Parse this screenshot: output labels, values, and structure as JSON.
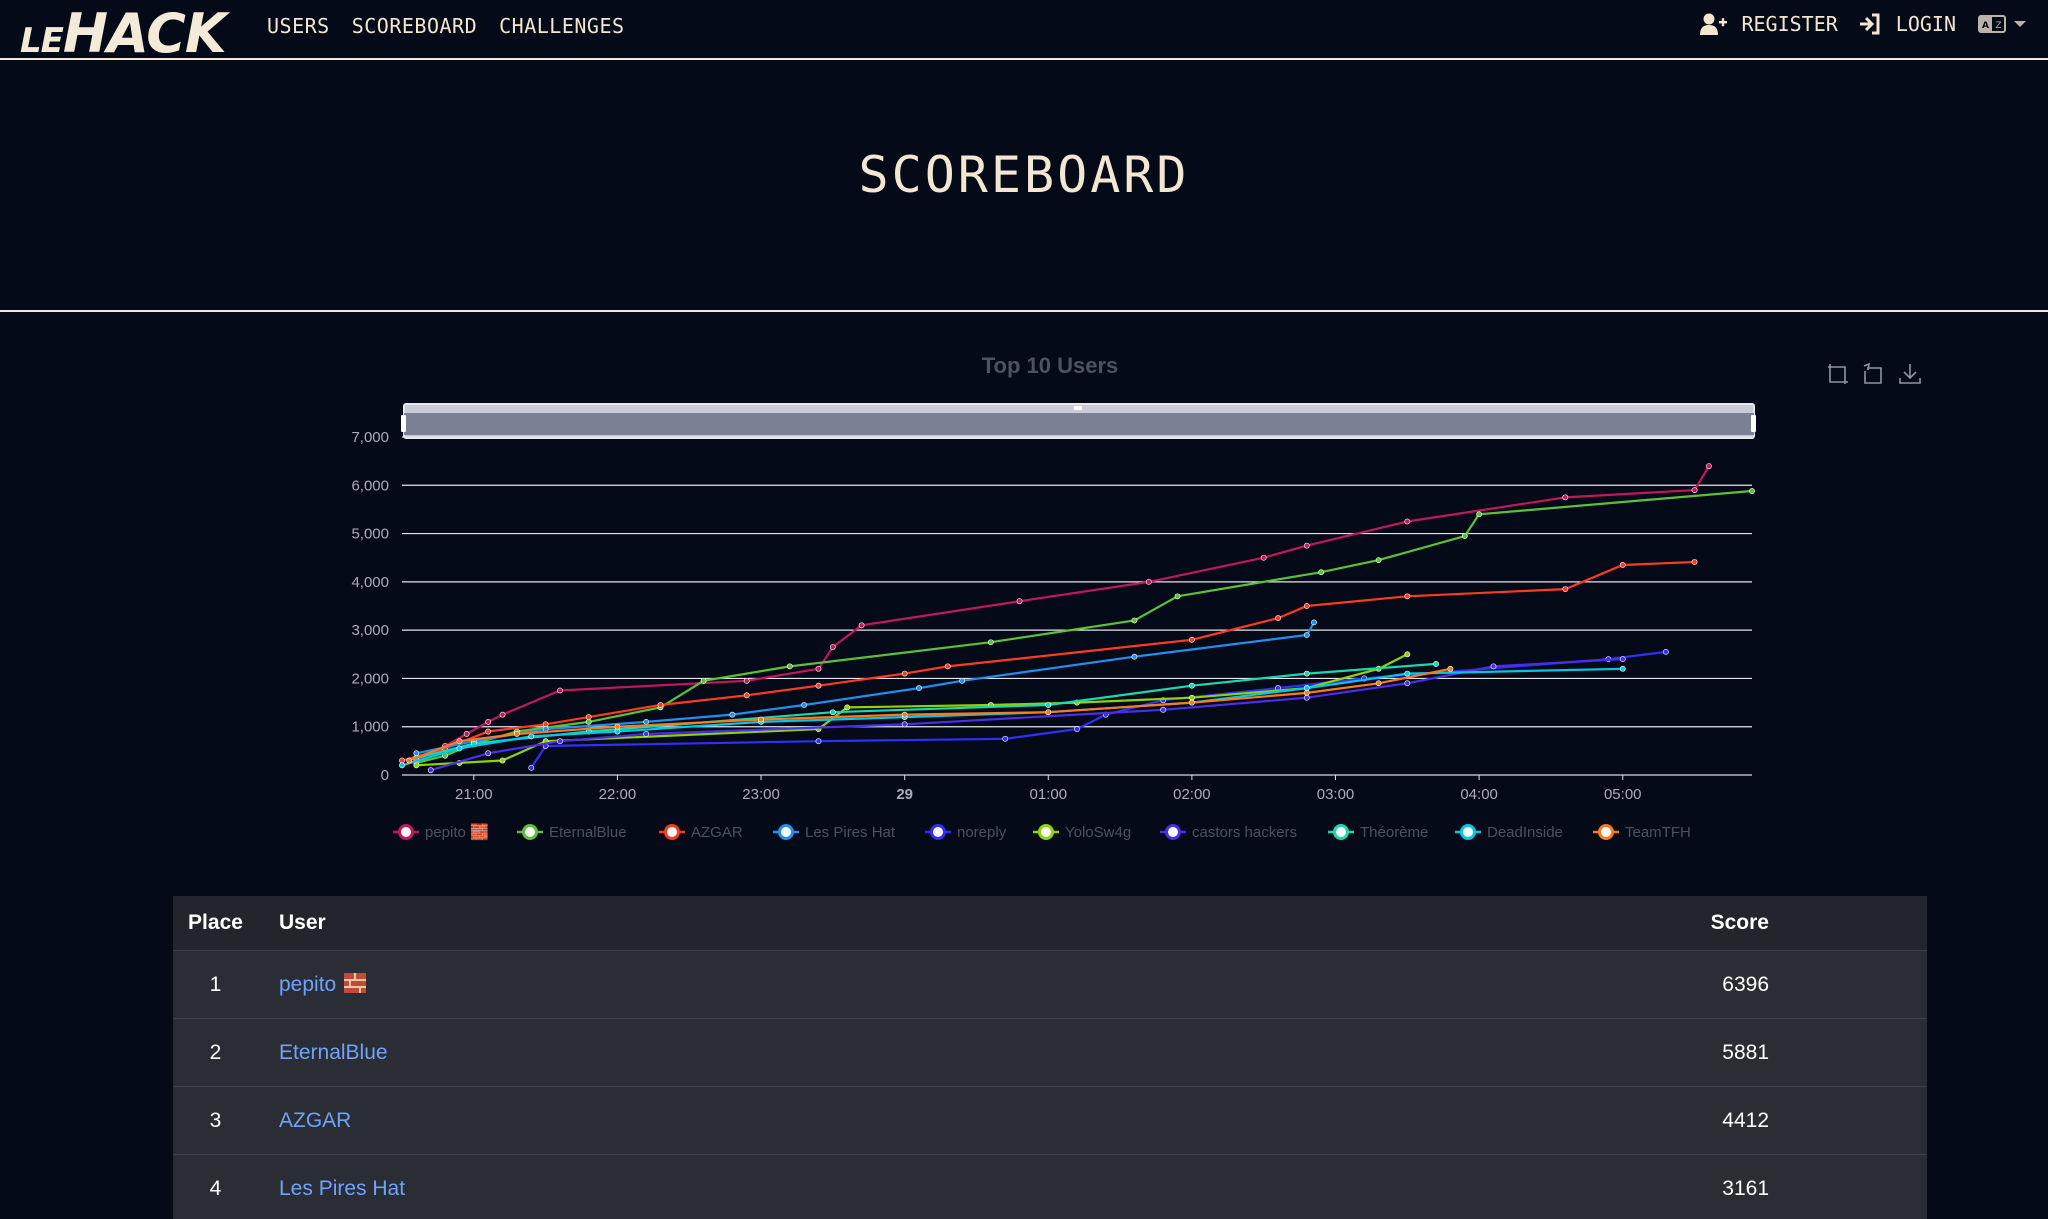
{
  "nav": {
    "logo_le": "LE",
    "logo_hack": "HACK",
    "links": [
      "USERS",
      "SCOREBOARD",
      "CHALLENGES"
    ],
    "register": "REGISTER",
    "login": "LOGIN",
    "icons": [
      "user-plus-icon",
      "sign-in-icon",
      "language-icon",
      "caret-down-icon"
    ]
  },
  "page": {
    "title": "SCOREBOARD"
  },
  "toolbox": [
    "zoom-icon",
    "zoom-reset-icon",
    "download-icon"
  ],
  "chart_data": {
    "type": "line",
    "title": "Top 10 Users",
    "y_axis": {
      "min": 0,
      "max": 7000,
      "ticks": [
        "0",
        "1,000",
        "2,000",
        "3,000",
        "4,000",
        "5,000",
        "6,000",
        "7,000"
      ]
    },
    "x_axis": {
      "min": 20.5,
      "max": 29.9,
      "ticks": [
        {
          "v": 21,
          "label": "21:00"
        },
        {
          "v": 22,
          "label": "22:00"
        },
        {
          "v": 23,
          "label": "23:00"
        },
        {
          "v": 24,
          "label": "29",
          "bold": true
        },
        {
          "v": 25,
          "label": "01:00"
        },
        {
          "v": 26,
          "label": "02:00"
        },
        {
          "v": 27,
          "label": "03:00"
        },
        {
          "v": 28,
          "label": "04:00"
        },
        {
          "v": 29,
          "label": "05:00"
        }
      ]
    },
    "grid": true,
    "legend": "bottom",
    "series": [
      {
        "name": "pepito 🧱",
        "color": "#c2185b",
        "points": [
          [
            20.6,
            300
          ],
          [
            20.8,
            600
          ],
          [
            20.95,
            850
          ],
          [
            21.1,
            1100
          ],
          [
            21.2,
            1250
          ],
          [
            21.6,
            1750
          ],
          [
            22.9,
            1950
          ],
          [
            23.4,
            2200
          ],
          [
            23.5,
            2650
          ],
          [
            23.7,
            3100
          ],
          [
            24.8,
            3600
          ],
          [
            25.7,
            4000
          ],
          [
            26.5,
            4500
          ],
          [
            26.8,
            4750
          ],
          [
            27.5,
            5250
          ],
          [
            28.6,
            5750
          ],
          [
            29.5,
            5900
          ],
          [
            29.6,
            6396
          ]
        ]
      },
      {
        "name": "EternalBlue",
        "color": "#5bc236",
        "points": [
          [
            20.6,
            250
          ],
          [
            20.8,
            400
          ],
          [
            21.0,
            650
          ],
          [
            21.3,
            900
          ],
          [
            21.8,
            1100
          ],
          [
            22.3,
            1400
          ],
          [
            22.6,
            1950
          ],
          [
            23.2,
            2250
          ],
          [
            24.6,
            2750
          ],
          [
            25.6,
            3200
          ],
          [
            25.9,
            3700
          ],
          [
            26.9,
            4200
          ],
          [
            27.3,
            4450
          ],
          [
            27.9,
            4950
          ],
          [
            28.0,
            5400
          ],
          [
            29.9,
            5881
          ]
        ]
      },
      {
        "name": "AZGAR",
        "color": "#ff3b1f",
        "points": [
          [
            20.5,
            300
          ],
          [
            20.8,
            550
          ],
          [
            21.1,
            900
          ],
          [
            21.5,
            1050
          ],
          [
            21.8,
            1200
          ],
          [
            22.3,
            1450
          ],
          [
            22.9,
            1650
          ],
          [
            23.4,
            1850
          ],
          [
            24.0,
            2100
          ],
          [
            24.3,
            2250
          ],
          [
            26.0,
            2800
          ],
          [
            26.6,
            3250
          ],
          [
            26.8,
            3500
          ],
          [
            27.5,
            3700
          ],
          [
            28.6,
            3850
          ],
          [
            29.0,
            4350
          ],
          [
            29.5,
            4412
          ]
        ]
      },
      {
        "name": "Les Pires Hat",
        "color": "#1f8ff0",
        "points": [
          [
            20.6,
            450
          ],
          [
            21.0,
            700
          ],
          [
            21.5,
            950
          ],
          [
            22.2,
            1100
          ],
          [
            22.8,
            1250
          ],
          [
            23.3,
            1450
          ],
          [
            24.1,
            1800
          ],
          [
            24.4,
            1950
          ],
          [
            25.6,
            2450
          ],
          [
            26.8,
            2900
          ],
          [
            26.85,
            3161
          ]
        ]
      },
      {
        "name": "noreply",
        "color": "#2f2fff",
        "points": [
          [
            21.4,
            150
          ],
          [
            21.5,
            600
          ],
          [
            23.4,
            700
          ],
          [
            24.7,
            750
          ],
          [
            25.2,
            950
          ],
          [
            25.4,
            1250
          ],
          [
            25.8,
            1550
          ],
          [
            26.6,
            1800
          ],
          [
            27.2,
            2000
          ],
          [
            28.9,
            2400
          ],
          [
            29.3,
            2550
          ]
        ]
      },
      {
        "name": "YoloSw4g",
        "color": "#8fd400",
        "points": [
          [
            20.6,
            200
          ],
          [
            20.9,
            250
          ],
          [
            21.2,
            300
          ],
          [
            21.5,
            700
          ],
          [
            23.4,
            950
          ],
          [
            23.6,
            1400
          ],
          [
            24.6,
            1450
          ],
          [
            25.2,
            1500
          ],
          [
            26.0,
            1600
          ],
          [
            26.8,
            1800
          ],
          [
            27.3,
            2200
          ],
          [
            27.5,
            2500
          ]
        ]
      },
      {
        "name": "castors hackers",
        "color": "#4b2ee8",
        "points": [
          [
            20.7,
            100
          ],
          [
            21.1,
            450
          ],
          [
            21.6,
            700
          ],
          [
            22.2,
            850
          ],
          [
            24.0,
            1050
          ],
          [
            25.8,
            1350
          ],
          [
            26.8,
            1600
          ],
          [
            27.5,
            1900
          ],
          [
            28.1,
            2250
          ],
          [
            29.0,
            2400
          ]
        ]
      },
      {
        "name": "Théorème",
        "color": "#19d9b0",
        "points": [
          [
            20.6,
            350
          ],
          [
            21.0,
            650
          ],
          [
            21.8,
            900
          ],
          [
            23.5,
            1300
          ],
          [
            25.0,
            1450
          ],
          [
            26.0,
            1850
          ],
          [
            26.8,
            2100
          ],
          [
            27.7,
            2300
          ]
        ]
      },
      {
        "name": "DeadInside",
        "color": "#00c8e6",
        "points": [
          [
            20.5,
            200
          ],
          [
            20.9,
            550
          ],
          [
            21.4,
            800
          ],
          [
            22.0,
            900
          ],
          [
            23.0,
            1100
          ],
          [
            24.0,
            1200
          ],
          [
            25.0,
            1300
          ],
          [
            26.0,
            1500
          ],
          [
            26.8,
            1800
          ],
          [
            27.5,
            2100
          ],
          [
            29.0,
            2200
          ]
        ]
      },
      {
        "name": "TeamTFH",
        "color": "#ff7a1a",
        "points": [
          [
            20.55,
            300
          ],
          [
            20.9,
            700
          ],
          [
            21.3,
            850
          ],
          [
            22.0,
            1000
          ],
          [
            23.0,
            1150
          ],
          [
            24.0,
            1250
          ],
          [
            25.0,
            1300
          ],
          [
            26.0,
            1500
          ],
          [
            26.8,
            1700
          ],
          [
            27.3,
            1900
          ],
          [
            27.8,
            2200
          ]
        ]
      }
    ]
  },
  "table": {
    "headers": {
      "place": "Place",
      "user": "User",
      "score": "Score"
    },
    "rows": [
      {
        "place": "1",
        "user": "pepito",
        "brick": true,
        "score": "6396"
      },
      {
        "place": "2",
        "user": "EternalBlue",
        "score": "5881"
      },
      {
        "place": "3",
        "user": "AZGAR",
        "score": "4412"
      },
      {
        "place": "4",
        "user": "Les Pires Hat",
        "score": "3161"
      }
    ]
  }
}
